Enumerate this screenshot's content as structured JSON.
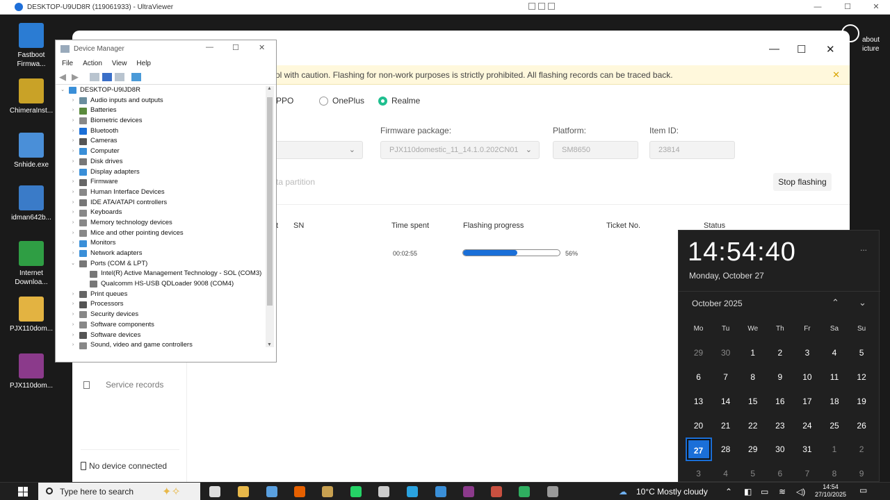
{
  "viewer": {
    "title": "DESKTOP-U9UD8R (119061933) - UltraViewer",
    "controls": {
      "minimize": "—",
      "restore": "☐",
      "close": "✕"
    }
  },
  "desktop_icons": [
    {
      "label": "Fastboot\nFirmwa...",
      "color": "#2b7cd3"
    },
    {
      "label": "ChimeraInst...",
      "color": "#c9a227"
    },
    {
      "label": "Snhide.exe",
      "color": "#4a8fd8"
    },
    {
      "label": "idman642b...",
      "color": "#3a7bc8"
    },
    {
      "label": "Internet\nDownloa...",
      "color": "#2f9e44"
    },
    {
      "label": "PJX110dom...",
      "color": "#e3b341"
    },
    {
      "label": "PJX110dom...",
      "color": "#8b3a8b"
    }
  ],
  "right_desktop_icon": {
    "label": "about\nicture"
  },
  "flash_tool": {
    "controls": {
      "minimize": "—",
      "maximize": "☐",
      "close": "✕"
    },
    "warning": "ol with caution. Flashing for non-work purposes is strictly prohibited. All flashing records can be traced back.",
    "brands": [
      {
        "label": "PPO",
        "selected": false
      },
      {
        "label": "OnePlus",
        "selected": false
      },
      {
        "label": "Realme",
        "selected": true
      }
    ],
    "fields": {
      "firmware_label": "Firmware package:",
      "firmware_value": "PJX110domestic_11_14.1.0.202CN01",
      "platform_label": "Platform:",
      "platform_value": "SM8650",
      "item_label": "Item ID:",
      "item_value": "23814"
    },
    "partition_text": "ta partition",
    "stop_button": "Stop flashing",
    "table": {
      "headers": [
        "t",
        "SN",
        "Time spent",
        "Flashing progress",
        "Ticket No.",
        "Status"
      ],
      "row": {
        "time": "00:02:55",
        "progress": 0.56,
        "progress_label": "56%"
      }
    },
    "sidebar": {
      "service_records": "Service records",
      "no_device": "No device connected"
    }
  },
  "device_manager": {
    "title": "Device Manager",
    "controls": {
      "minimize": "—",
      "maximize": "☐",
      "close": "✕"
    },
    "menu": [
      "File",
      "Action",
      "View",
      "Help"
    ],
    "root": "DESKTOP-U9IJD8R",
    "items": [
      {
        "label": "Audio inputs and outputs",
        "color": "#6b8e9e",
        "level": 1,
        "arrow": "›"
      },
      {
        "label": "Batteries",
        "color": "#5a8a3c",
        "level": 1,
        "arrow": "›"
      },
      {
        "label": "Biometric devices",
        "color": "#888888",
        "level": 1,
        "arrow": "›"
      },
      {
        "label": "Bluetooth",
        "color": "#1a6fd8",
        "level": 1,
        "arrow": "›"
      },
      {
        "label": "Cameras",
        "color": "#555555",
        "level": 1,
        "arrow": "›"
      },
      {
        "label": "Computer",
        "color": "#3a8fd8",
        "level": 1,
        "arrow": "›"
      },
      {
        "label": "Disk drives",
        "color": "#777777",
        "level": 1,
        "arrow": "›"
      },
      {
        "label": "Display adapters",
        "color": "#3a8fd8",
        "level": 1,
        "arrow": "›"
      },
      {
        "label": "Firmware",
        "color": "#666666",
        "level": 1,
        "arrow": "›"
      },
      {
        "label": "Human Interface Devices",
        "color": "#888888",
        "level": 1,
        "arrow": "›"
      },
      {
        "label": "IDE ATA/ATAPI controllers",
        "color": "#777777",
        "level": 1,
        "arrow": "›"
      },
      {
        "label": "Keyboards",
        "color": "#888888",
        "level": 1,
        "arrow": "›"
      },
      {
        "label": "Memory technology devices",
        "color": "#888888",
        "level": 1,
        "arrow": "›"
      },
      {
        "label": "Mice and other pointing devices",
        "color": "#888888",
        "level": 1,
        "arrow": "›"
      },
      {
        "label": "Monitors",
        "color": "#3a8fd8",
        "level": 1,
        "arrow": "›"
      },
      {
        "label": "Network adapters",
        "color": "#3a8fd8",
        "level": 1,
        "arrow": "›"
      },
      {
        "label": "Ports (COM & LPT)",
        "color": "#777777",
        "level": 1,
        "arrow": "⌄"
      },
      {
        "label": "Intel(R) Active Management Technology - SOL (COM3)",
        "color": "#777777",
        "level": 2,
        "arrow": ""
      },
      {
        "label": "Qualcomm HS-USB QDLoader 9008 (COM4)",
        "color": "#777777",
        "level": 2,
        "arrow": ""
      },
      {
        "label": "Print queues",
        "color": "#666666",
        "level": 1,
        "arrow": "›"
      },
      {
        "label": "Processors",
        "color": "#555555",
        "level": 1,
        "arrow": "›"
      },
      {
        "label": "Security devices",
        "color": "#888888",
        "level": 1,
        "arrow": "›"
      },
      {
        "label": "Software components",
        "color": "#888888",
        "level": 1,
        "arrow": "›"
      },
      {
        "label": "Software devices",
        "color": "#555555",
        "level": 1,
        "arrow": "›"
      },
      {
        "label": "Sound, video and game controllers",
        "color": "#888888",
        "level": 1,
        "arrow": "›"
      }
    ]
  },
  "calendar": {
    "time": "14:54:40",
    "date": "Monday, October 27",
    "month": "October 2025",
    "more": "...",
    "weekdays": [
      "Mo",
      "Tu",
      "We",
      "Th",
      "Fr",
      "Sa",
      "Su"
    ],
    "weeks": [
      [
        {
          "d": "29",
          "dim": true
        },
        {
          "d": "30",
          "dim": true
        },
        {
          "d": "1"
        },
        {
          "d": "2"
        },
        {
          "d": "3"
        },
        {
          "d": "4"
        },
        {
          "d": "5"
        }
      ],
      [
        {
          "d": "6"
        },
        {
          "d": "7"
        },
        {
          "d": "8"
        },
        {
          "d": "9"
        },
        {
          "d": "10"
        },
        {
          "d": "11"
        },
        {
          "d": "12"
        }
      ],
      [
        {
          "d": "13"
        },
        {
          "d": "14"
        },
        {
          "d": "15"
        },
        {
          "d": "16"
        },
        {
          "d": "17"
        },
        {
          "d": "18"
        },
        {
          "d": "19"
        }
      ],
      [
        {
          "d": "20"
        },
        {
          "d": "21"
        },
        {
          "d": "22"
        },
        {
          "d": "23"
        },
        {
          "d": "24"
        },
        {
          "d": "25"
        },
        {
          "d": "26"
        }
      ],
      [
        {
          "d": "27",
          "today": true
        },
        {
          "d": "28"
        },
        {
          "d": "29"
        },
        {
          "d": "30"
        },
        {
          "d": "31"
        },
        {
          "d": "1",
          "dim": true
        },
        {
          "d": "2",
          "dim": true
        }
      ],
      [
        {
          "d": "3",
          "dim": true
        },
        {
          "d": "4",
          "dim": true
        },
        {
          "d": "5",
          "dim": true
        },
        {
          "d": "6",
          "dim": true
        },
        {
          "d": "7",
          "dim": true
        },
        {
          "d": "8",
          "dim": true
        },
        {
          "d": "9",
          "dim": true
        }
      ]
    ]
  },
  "taskbar": {
    "search_placeholder": "Type here to search",
    "weather": "10°C  Mostly cloudy",
    "time": "14:54",
    "date": "27/10/2025",
    "apps": [
      {
        "name": "task-view-icon",
        "color": "#dddddd"
      },
      {
        "name": "file-explorer-icon",
        "color": "#e8b84a"
      },
      {
        "name": "notepad-icon",
        "color": "#5aa0e0"
      },
      {
        "name": "firefox-icon",
        "color": "#e66000"
      },
      {
        "name": "user-app-icon",
        "color": "#c8a050"
      },
      {
        "name": "whatsapp-icon",
        "color": "#25d366"
      },
      {
        "name": "settings-icon",
        "color": "#cccccc"
      },
      {
        "name": "telegram-icon",
        "color": "#2aa3e0"
      },
      {
        "name": "remote-app-icon",
        "color": "#3a8fd8"
      },
      {
        "name": "archive-app-icon",
        "color": "#8b3a8b"
      },
      {
        "name": "image-app-icon",
        "color": "#c85040"
      },
      {
        "name": "sync-app-icon",
        "color": "#2fae60"
      },
      {
        "name": "tool-app-icon",
        "color": "#9a9a9a"
      }
    ]
  }
}
